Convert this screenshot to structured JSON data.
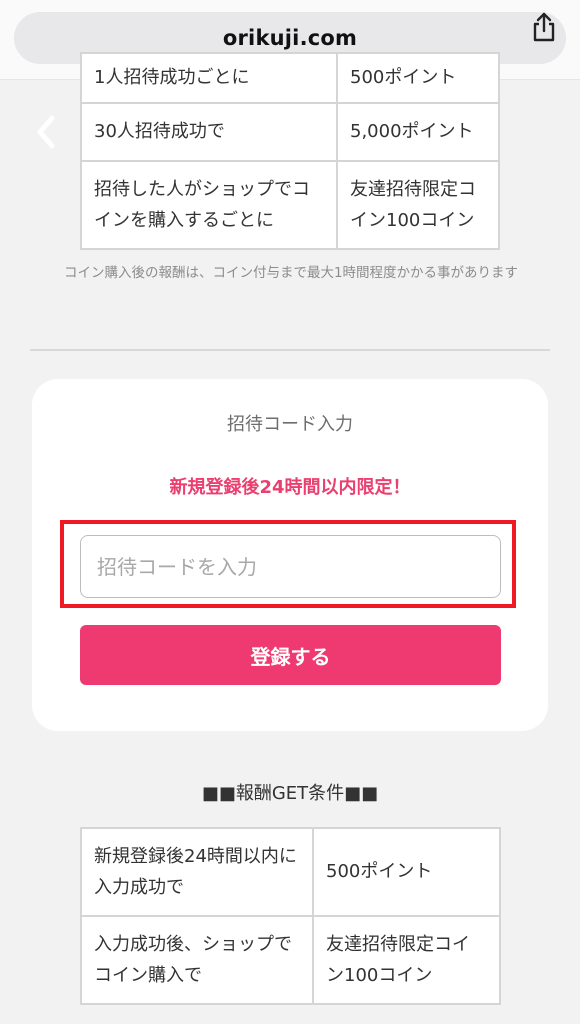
{
  "browser": {
    "url": "orikuji.com",
    "share_icon": "share-icon"
  },
  "top_table": {
    "rows": [
      {
        "condition": "1人招待成功ごとに",
        "reward": "500ポイント"
      },
      {
        "condition": "30人招待成功で",
        "reward": "5,000ポイント"
      },
      {
        "condition": "招待した人がショップでコインを購入するごとに",
        "reward": "友達招待限定コイン100コイン"
      }
    ]
  },
  "note": "コイン購入後の報酬は、コイン付与まで最大1時間程度かかる事があります",
  "invite_card": {
    "title": "招待コード入力",
    "limited_notice": "新規登録後24時間以内限定！",
    "input_placeholder": "招待コードを入力",
    "input_value": "",
    "register_button": "登録する"
  },
  "conditions": {
    "heading": "■■報酬GET条件■■",
    "rows": [
      {
        "condition": "新規登録後24時間以内に入力成功で",
        "reward": "500ポイント"
      },
      {
        "condition": "入力成功後、ショップでコイン購入で",
        "reward": "友達招待限定コイン100コイン"
      }
    ]
  },
  "colors": {
    "accent": "#ef3a71",
    "notice": "#ea3f6f",
    "highlight": "#ee1b24"
  }
}
